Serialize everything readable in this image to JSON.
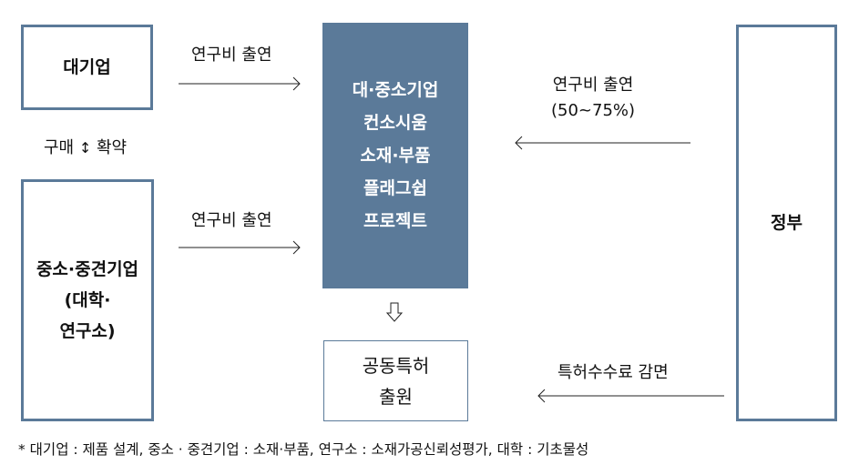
{
  "large_company": "대기업",
  "relation": {
    "left": "구매",
    "right": "확약",
    "icon": "up-down-arrow-icon"
  },
  "sme": [
    "중소·중견기업",
    "(대학·",
    "연구소)"
  ],
  "center": [
    "대·중소기업",
    "컨소시움",
    "소재·부품",
    "플래그쉽",
    "프로젝트"
  ],
  "joint_patent": [
    "공동특허",
    "출원"
  ],
  "government": "정부",
  "arrow_labels": {
    "top": "연구비 출연",
    "bottom": "연구비 출연",
    "gov": [
      "연구비 출연",
      "(50~75%)"
    ],
    "fee": "특허수수료 감면"
  },
  "footnote": "*  대기업 : 제품 설계, 중소 · 중견기업 : 소재·부품, 연구소 : 소재가공신뢰성평가, 대학 : 기초물성",
  "colors": {
    "accent": "#5b7a99"
  }
}
